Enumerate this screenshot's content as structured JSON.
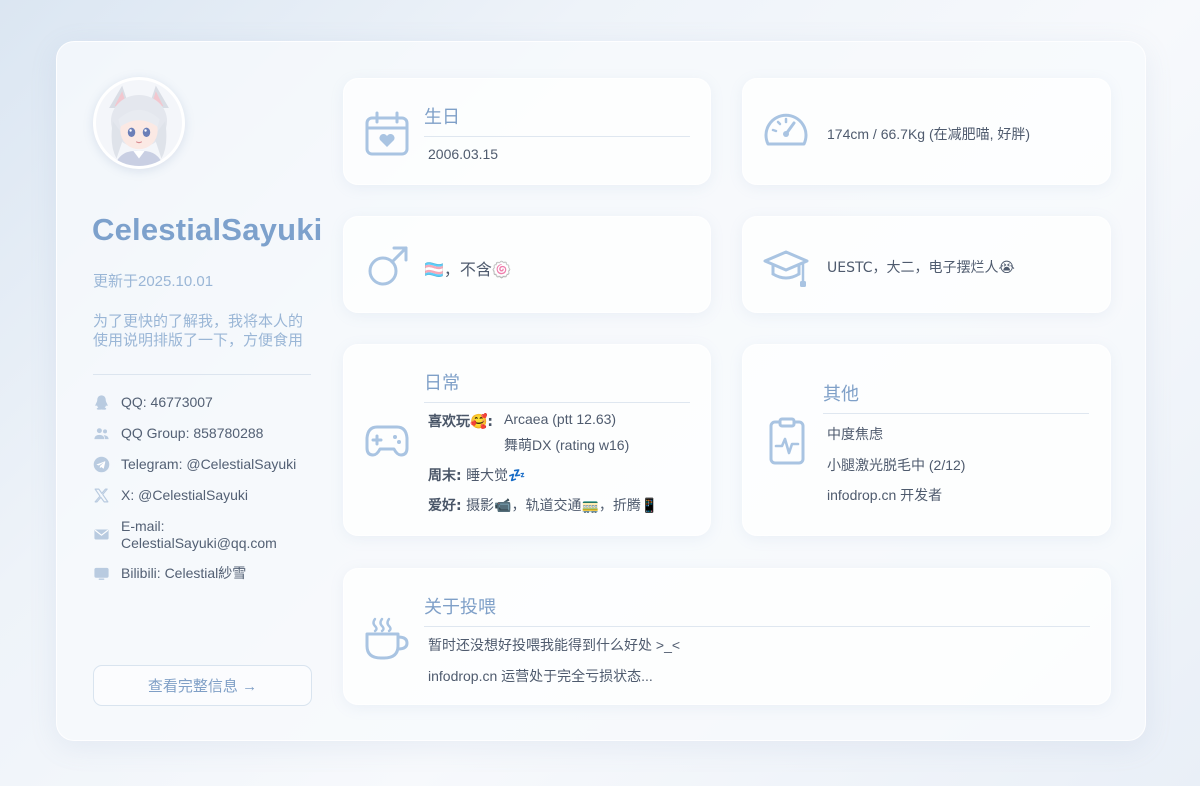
{
  "profile": {
    "username": "CelestialSayuki",
    "updated": "更新于2025.10.01",
    "description": "为了更快的了解我，我将本人的使用说明排版了一下，方便食用",
    "view_full_button": "查看完整信息 →"
  },
  "contacts": [
    {
      "icon": "qq-penguin-icon",
      "text": "QQ: 46773007"
    },
    {
      "icon": "group-users-icon",
      "text": "QQ Group: 858780288"
    },
    {
      "icon": "telegram-icon",
      "text": "Telegram: @CelestialSayuki"
    },
    {
      "icon": "x-logo-icon",
      "text": "X: @CelestialSayuki"
    },
    {
      "icon": "email-icon",
      "text": "E-mail: CelestialSayuki@qq.com"
    },
    {
      "icon": "tv-screen-icon",
      "text": "Bilibili: Celestial紗雪"
    }
  ],
  "cards": {
    "birthday": {
      "icon": "calendar-heart-icon",
      "title": "生日",
      "text": "2006.03.15"
    },
    "body": {
      "icon": "speedometer-icon",
      "text": "174cm / 66.7Kg (在减肥喵, 好胖)"
    },
    "gender": {
      "icon": "male-symbol-icon",
      "text": "🏳️‍⚧️，不含🍥"
    },
    "education": {
      "icon": "graduation-cap-icon",
      "text": "UESTC，大二，电子摆烂人😭"
    },
    "daily": {
      "icon": "gamepad-icon",
      "title": "日常",
      "likes_label": "喜欢玩🥰:",
      "likes_1": "Arcaea (ptt 12.63)",
      "likes_2": "舞萌DX (rating w16)",
      "weekend_label": "周末:",
      "weekend_value": "睡大觉💤",
      "hobby_label": "爱好:",
      "hobby_value": "摄影📹，轨道交通🚃，折腾📱"
    },
    "other": {
      "icon": "clipboard-pulse-icon",
      "title": "其他",
      "items": [
        "中度焦虑",
        "小腿激光脱毛中 (2/12)",
        "infodrop.cn 开发者"
      ]
    },
    "donate": {
      "icon": "coffee-cup-icon",
      "title": "关于投喂",
      "line_1": "暂时还没想好投喂我能得到什么好处 >_<",
      "line_2": "infodrop.cn 运营处于完全亏损状态..."
    }
  },
  "colors": {
    "accent": "#7da1cc",
    "icon": "#a9c4e2",
    "text": "#4f5b6e"
  }
}
